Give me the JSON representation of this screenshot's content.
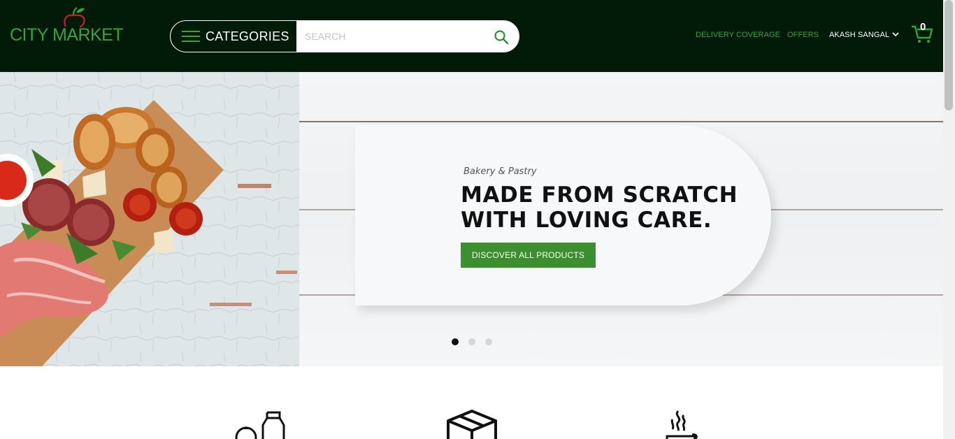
{
  "header": {
    "logo_text": "CITY MARKET",
    "categories_label": "CATEGORIES",
    "search_placeholder": "SEARCH",
    "nav": {
      "delivery_coverage": "DELIVERY COVERAGE",
      "offers": "OFFERS",
      "user_name": "AKASH SANGAL"
    },
    "cart_count": "0"
  },
  "hero": {
    "subtitle": "Bakery & Pastry",
    "title_line1": "MADE FROM SCRATCH",
    "title_line2": "WITH LOVING CARE.",
    "cta_label": "DISCOVER ALL PRODUCTS",
    "slides_count": 3,
    "active_slide": 1
  },
  "features": [
    {
      "icon": "grocery-bottle-icon"
    },
    {
      "icon": "box-icon"
    },
    {
      "icon": "hot-food-icon"
    }
  ],
  "colors": {
    "header_bg": "#021b09",
    "accent_green": "#36a33f",
    "cta_green": "#3b8f2e"
  }
}
